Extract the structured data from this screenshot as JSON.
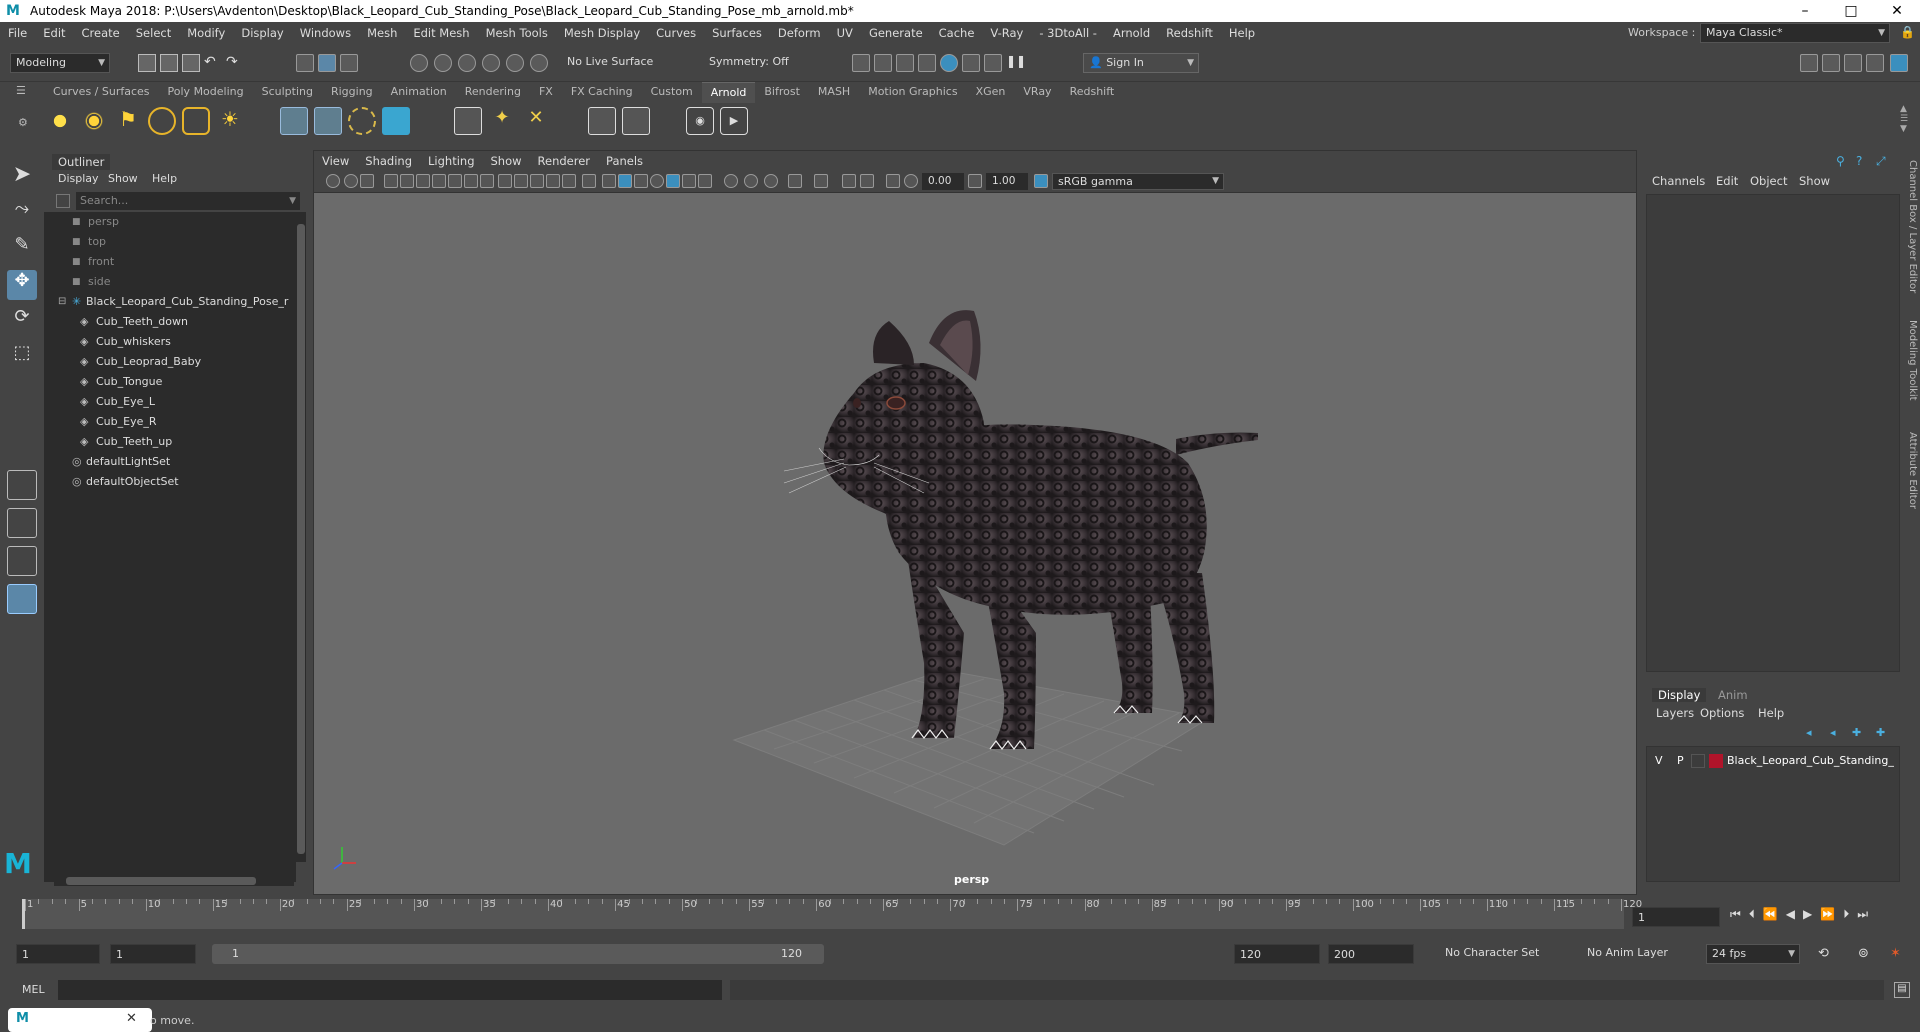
{
  "window": {
    "title": "Autodesk Maya 2018: P:\\Users\\Avdenton\\Desktop\\Black_Leopard_Cub_Standing_Pose\\Black_Leopard_Cub_Standing_Pose_mb_arnold.mb*",
    "logo": "M",
    "minimize": "–",
    "maximize": "□",
    "close": "✕"
  },
  "menubar": {
    "items": [
      "File",
      "Edit",
      "Create",
      "Select",
      "Modify",
      "Display",
      "Windows",
      "Mesh",
      "Edit Mesh",
      "Mesh Tools",
      "Mesh Display",
      "Curves",
      "Surfaces",
      "Deform",
      "UV",
      "Generate",
      "Cache",
      "V-Ray",
      "- 3DtoAll -",
      "Arnold",
      "Redshift",
      "Help"
    ],
    "workspace_label": "Workspace :",
    "workspace_value": "Maya Classic*"
  },
  "statusline": {
    "mode": "Modeling",
    "live_surface": "No Live Surface",
    "symmetry": "Symmetry: Off",
    "sign_in": "Sign In"
  },
  "shelf": {
    "tabs": [
      "Curves / Surfaces",
      "Poly Modeling",
      "Sculpting",
      "Rigging",
      "Animation",
      "Rendering",
      "FX",
      "FX Caching",
      "Custom",
      "Arnold",
      "Bifrost",
      "MASH",
      "Motion Graphics",
      "XGen",
      "VRay",
      "Redshift"
    ],
    "active_tab": "Arnold"
  },
  "outliner": {
    "title": "Outliner",
    "menu": [
      "Display",
      "Show",
      "Help"
    ],
    "search_placeholder": "Search...",
    "cameras": [
      "persp",
      "top",
      "front",
      "side"
    ],
    "group": "Black_Leopard_Cub_Standing_Pose_r",
    "children": [
      "Cub_Teeth_down",
      "Cub_whiskers",
      "Cub_Leoprad_Baby",
      "Cub_Tongue",
      "Cub_Eye_L",
      "Cub_Eye_R",
      "Cub_Teeth_up"
    ],
    "sets": [
      "defaultLightSet",
      "defaultObjectSet"
    ]
  },
  "viewport": {
    "menu": [
      "View",
      "Shading",
      "Lighting",
      "Show",
      "Renderer",
      "Panels"
    ],
    "field_exposure": "0.00",
    "field_gamma": "1.00",
    "color_space": "sRGB gamma",
    "camera_label": "persp"
  },
  "channelbox": {
    "menu": [
      "Channels",
      "Edit",
      "Object",
      "Show"
    ],
    "side_tabs": [
      "Channel Box / Layer Editor",
      "Modeling Toolkit",
      "Attribute Editor"
    ]
  },
  "layereditor": {
    "tabs": [
      "Display",
      "Anim"
    ],
    "menu": [
      "Layers",
      "Options",
      "Help"
    ],
    "layer": {
      "v": "V",
      "p": "P",
      "name": "Black_Leopard_Cub_Standing_",
      "color": "#b0142a"
    }
  },
  "timeslider": {
    "ticks": [
      "1",
      "5",
      "10",
      "15",
      "20",
      "25",
      "30",
      "35",
      "40",
      "45",
      "50",
      "55",
      "60",
      "65",
      "70",
      "75",
      "80",
      "85",
      "90",
      "95",
      "100",
      "105",
      "110",
      "115",
      "120"
    ],
    "current_frame": "1"
  },
  "rangeslider": {
    "start": "1",
    "range_start": "1",
    "slider_start": "1",
    "slider_end": "120",
    "range_end": "120",
    "end": "200",
    "character_set": "No Character Set",
    "anim_layer": "No Anim Layer",
    "fps": "24 fps"
  },
  "cmdline": {
    "label": "MEL"
  },
  "helpline": {
    "text": "o move."
  }
}
